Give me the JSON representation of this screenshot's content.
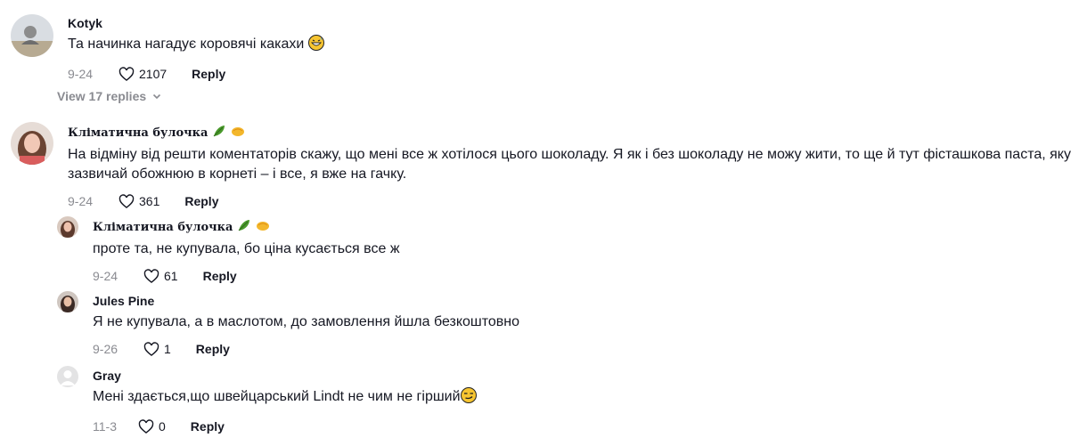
{
  "comments": [
    {
      "username": "Kotyk",
      "text": "Та начинка нагадує коровячі какахи",
      "emoji": "grinning-sweat",
      "date": "9-24",
      "likes": "2107",
      "reply_label": "Reply"
    },
    {
      "username": "Кліматична булочка",
      "text": "На відміну від решти коментаторів скажу, що мені все ж хотілося цього шоколаду. Я як і без шоколаду не можу жити, то ще й тут фісташкова паста, яку зазвичай обожнюю в корнеті – і все, я вже на гачку.",
      "date": "9-24",
      "likes": "361",
      "reply_label": "Reply"
    }
  ],
  "view_replies": "View 17 replies",
  "replies": [
    {
      "username": "Кліматична булочка",
      "text": "проте та, не купувала, бо ціна кусається все ж",
      "date": "9-24",
      "likes": "61",
      "reply_label": "Reply"
    },
    {
      "username": "Jules Pine",
      "text": "Я не купувала, а в маслотом, до замовлення йшла безкоштовно",
      "date": "9-26",
      "likes": "1",
      "reply_label": "Reply"
    },
    {
      "username": "Gray",
      "text": "Мені здається,що швейцарський Lindt не чим не гірший",
      "emoji": "smirk",
      "date": "11-3",
      "likes": "0",
      "reply_label": "Reply"
    }
  ],
  "colors": {
    "text": "#161823",
    "muted": "#8a8b91",
    "emoji_yellow": "#f7c531"
  }
}
